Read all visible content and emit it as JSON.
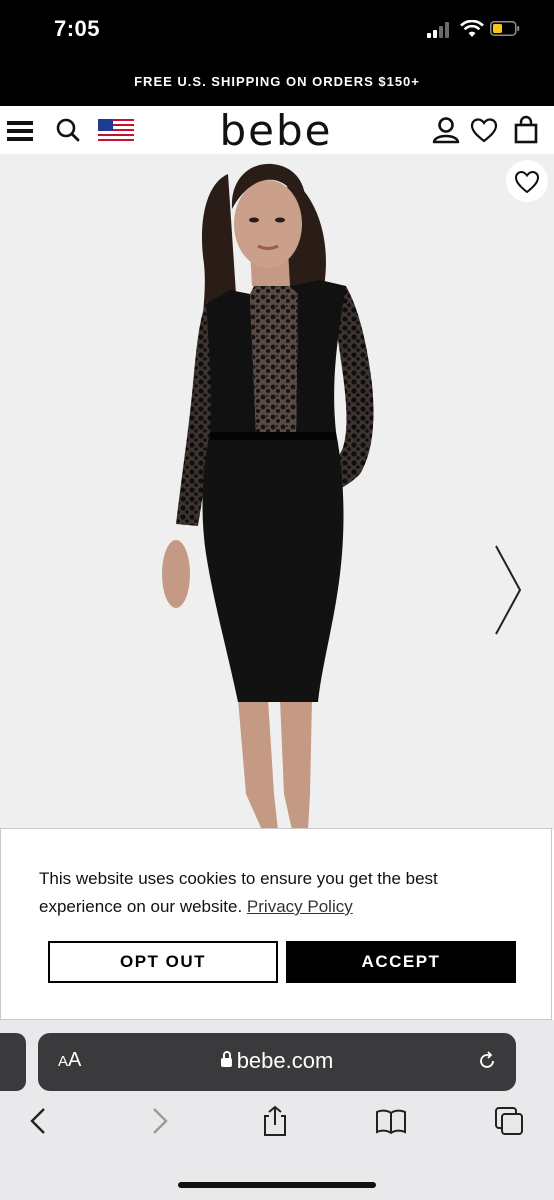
{
  "status_bar": {
    "time": "7:05"
  },
  "promo": {
    "text": "FREE U.S. SHIPPING ON ORDERS $150+"
  },
  "header": {
    "logo": "bebe",
    "icons": [
      "menu-icon",
      "search-icon",
      "us-flag-icon",
      "account-icon",
      "wishlist-heart-icon",
      "shopping-bag-icon"
    ]
  },
  "product": {
    "icons": [
      "favorite-heart-icon",
      "next-image-chevron-icon"
    ]
  },
  "cookie": {
    "message": "This website uses cookies to ensure you get the best experience on our website.",
    "policy_link": "Privacy Policy",
    "opt_out_label": "OPT OUT",
    "accept_label": "ACCEPT"
  },
  "browser": {
    "reader_label_large": "A",
    "reader_label_small": "A",
    "url": "bebe.com",
    "toolbar_icons": [
      "back-icon",
      "forward-icon",
      "share-icon",
      "bookmarks-icon",
      "tabs-icon"
    ]
  },
  "colors": {
    "black": "#000000",
    "image_bg": "#efefef",
    "browser_bar": "#3a3a3c"
  }
}
